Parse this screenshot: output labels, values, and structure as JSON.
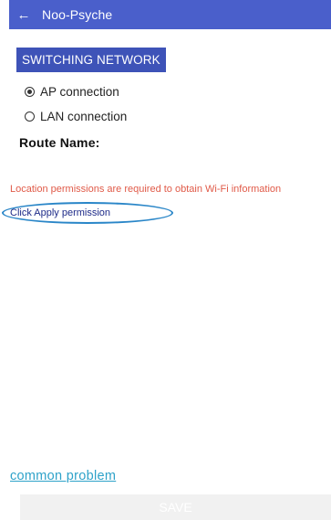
{
  "header": {
    "back_icon": "←",
    "title": "Noo-Psyche"
  },
  "switch_button": {
    "label": "SWITCHING NETWORK"
  },
  "connection_options": [
    {
      "label": "AP connection",
      "selected": true
    },
    {
      "label": "LAN connection",
      "selected": false
    }
  ],
  "route": {
    "label": "Route Name:"
  },
  "warning": {
    "text": "Location permissions are required to obtain Wi-Fi information"
  },
  "apply_link": {
    "label": "Click Apply permission"
  },
  "common_problem": {
    "label": "common problem"
  },
  "save_button": {
    "label": "SAVE"
  },
  "colors": {
    "header_bg": "#4a5fcb",
    "button_bg": "#3e53b8",
    "warning": "#e05a48",
    "link_dark": "#1d2a88",
    "link_light": "#2ea2c9",
    "annotation_circle": "#2a86c8"
  }
}
